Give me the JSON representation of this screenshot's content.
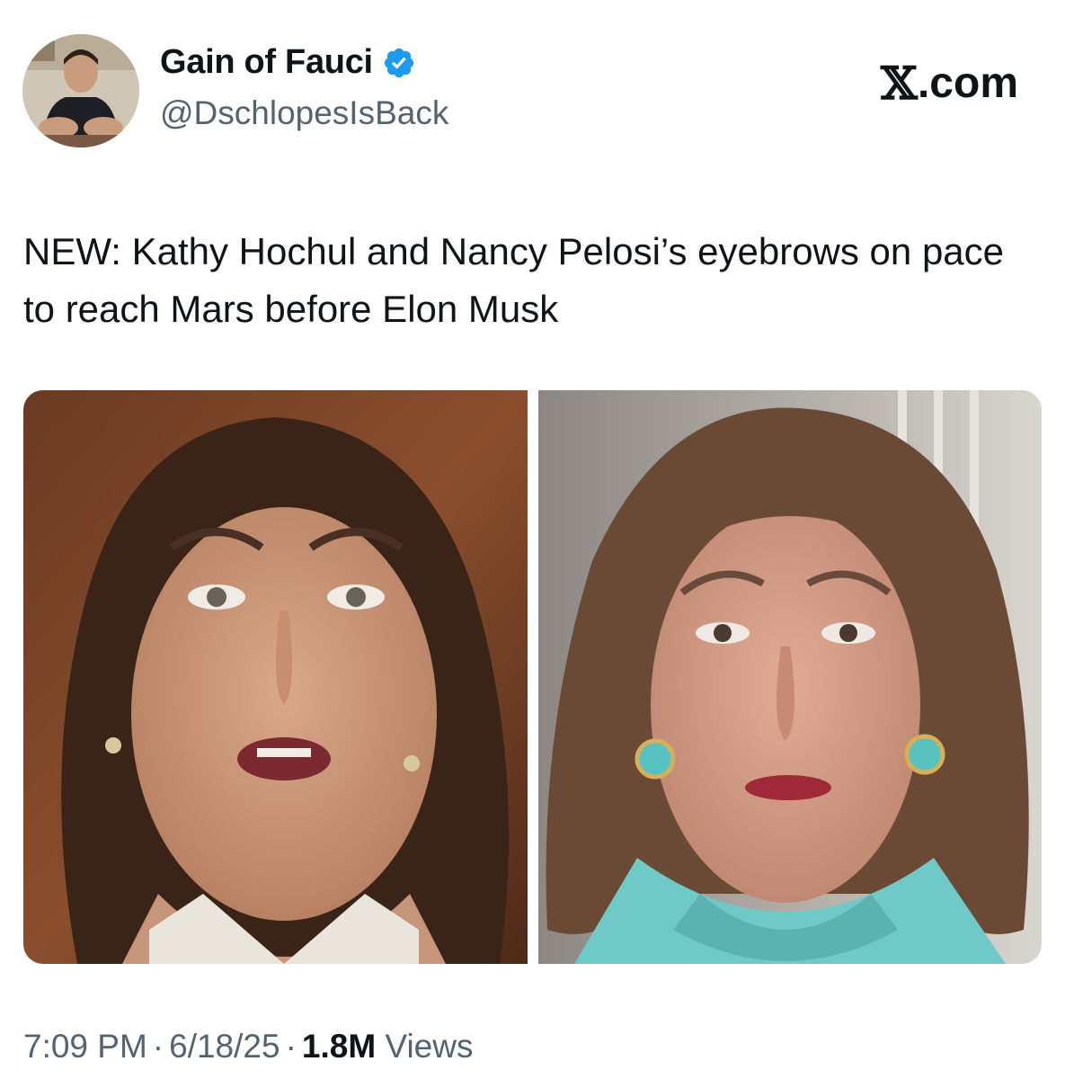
{
  "author": {
    "display_name": "Gain of Fauci",
    "handle": "@DschlopesIsBack",
    "verified": true,
    "avatar_icon": "profile-photo"
  },
  "brand": {
    "mark": "𝕏",
    "domain": ".com"
  },
  "tweet": {
    "text": "NEW: Kathy Hochul and Nancy Pelosi’s eyebrows on pace to reach Mars before Elon Musk"
  },
  "media": {
    "images": [
      "portrait-left",
      "portrait-right"
    ]
  },
  "meta": {
    "time": "7:09 PM",
    "separator": "·",
    "date": "6/18/25",
    "views_count": "1.8M",
    "views_label": "Views"
  },
  "colors": {
    "verified_badge": "#1d9bf0",
    "secondary_text": "#536471",
    "primary_text": "#0f1419"
  }
}
